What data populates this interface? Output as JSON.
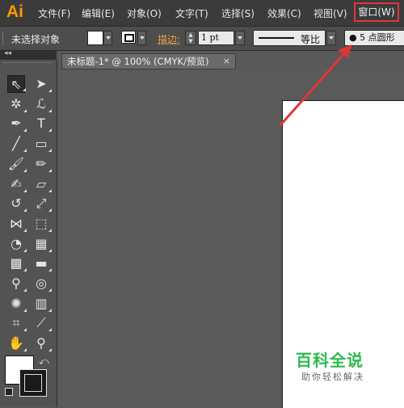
{
  "app": {
    "logo": "Ai"
  },
  "menu": {
    "items": [
      "文件(F)",
      "编辑(E)",
      "对象(O)",
      "文字(T)",
      "选择(S)",
      "效果(C)",
      "视图(V)"
    ],
    "window_label": "窗口(W)"
  },
  "control_bar": {
    "selection_status": "未选择对象",
    "stroke_label": "描边:",
    "stroke_weight": "1 pt",
    "profile_label": "等比",
    "brush_label": "● 5 点圆形"
  },
  "tools_header": {
    "collapse_glyph": "◂◂"
  },
  "document_tab": {
    "title": "未标题-1* @ 100% (CMYK/预览)",
    "close_glyph": "×"
  },
  "tools": [
    {
      "icon": "selection-tool-icon",
      "glyph": "⇖",
      "active": true
    },
    {
      "icon": "direct-selection-tool-icon",
      "glyph": "➤"
    },
    {
      "icon": "magic-wand-tool-icon",
      "glyph": "✲"
    },
    {
      "icon": "lasso-tool-icon",
      "glyph": "ℒ"
    },
    {
      "icon": "pen-tool-icon",
      "glyph": "✒"
    },
    {
      "icon": "type-tool-icon",
      "glyph": "T"
    },
    {
      "icon": "line-segment-tool-icon",
      "glyph": "╱"
    },
    {
      "icon": "rectangle-tool-icon",
      "glyph": "▭"
    },
    {
      "icon": "paintbrush-tool-icon",
      "glyph": "🖌"
    },
    {
      "icon": "pencil-tool-icon",
      "glyph": "✏"
    },
    {
      "icon": "blob-brush-tool-icon",
      "glyph": "✍"
    },
    {
      "icon": "eraser-tool-icon",
      "glyph": "▱"
    },
    {
      "icon": "rotate-tool-icon",
      "glyph": "↺"
    },
    {
      "icon": "scale-tool-icon",
      "glyph": "⤢"
    },
    {
      "icon": "width-tool-icon",
      "glyph": "⋈"
    },
    {
      "icon": "free-transform-tool-icon",
      "glyph": "⬚"
    },
    {
      "icon": "shape-builder-tool-icon",
      "glyph": "◔"
    },
    {
      "icon": "perspective-grid-tool-icon",
      "glyph": "▦"
    },
    {
      "icon": "mesh-tool-icon",
      "glyph": "▩"
    },
    {
      "icon": "gradient-tool-icon",
      "glyph": "▬"
    },
    {
      "icon": "eyedropper-tool-icon",
      "glyph": "⚲"
    },
    {
      "icon": "blend-tool-icon",
      "glyph": "◎"
    },
    {
      "icon": "symbol-sprayer-tool-icon",
      "glyph": "✺"
    },
    {
      "icon": "column-graph-tool-icon",
      "glyph": "▥"
    },
    {
      "icon": "artboard-tool-icon",
      "glyph": "⌗"
    },
    {
      "icon": "slice-tool-icon",
      "glyph": "⟋"
    },
    {
      "icon": "hand-tool-icon",
      "glyph": "✋"
    },
    {
      "icon": "zoom-tool-icon",
      "glyph": "⚲"
    }
  ],
  "colors": {
    "menubar_bg": "#3b3b3b",
    "logo": "#ff9a00",
    "highlight": "#e0353a",
    "watermark": "#2db84d"
  },
  "watermark": {
    "title": "百科全说",
    "subtitle": "助你轻松解决"
  }
}
